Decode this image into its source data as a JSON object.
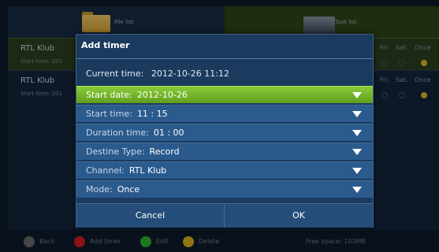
{
  "tabs": [
    {
      "label": "File list"
    },
    {
      "label": "Task list"
    }
  ],
  "list": {
    "rows": [
      {
        "channel": "RTL Klub",
        "start_time_label": "Start time: 201"
      },
      {
        "channel": "RTL Klub",
        "start_time_label": "Start time: 201"
      }
    ],
    "day_headers": [
      "Fri.",
      "Sat.",
      "Once"
    ]
  },
  "dialog": {
    "title": "Add timer",
    "current_time_label": "Current time:",
    "current_time_value": "2012-10-26  11:12",
    "fields": [
      {
        "label": "Start date:",
        "value": "2012-10-26"
      },
      {
        "label": "Start time:",
        "value": "11 : 15"
      },
      {
        "label": "Duration time:",
        "value": "01 : 00"
      },
      {
        "label": "Destine Type:",
        "value": "Record"
      },
      {
        "label": "Channel:",
        "value": "RTL Klub"
      },
      {
        "label": "Mode:",
        "value": "Once"
      }
    ],
    "cancel_label": "Cancel",
    "ok_label": "OK"
  },
  "bottom_bar": {
    "back_label": "Back",
    "add_timer_label": "Add timer",
    "edit_label": "Edit",
    "delete_label": "Delete",
    "free_space": "Free space: 103MB"
  },
  "colors": {
    "dialog_bg": "#1c3a5e",
    "active_row": "#7bbf2e",
    "key_red": "#d81e1e",
    "key_green": "#2fb52f",
    "key_yellow": "#e0b21c",
    "key_grey": "#666666"
  }
}
